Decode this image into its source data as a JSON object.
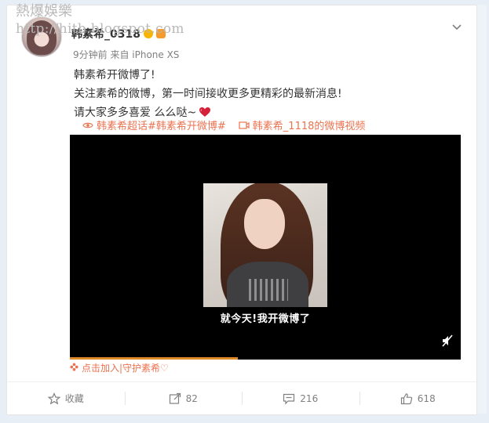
{
  "watermark": {
    "title": "熱爆娛樂",
    "url": "http://hitb.blogspot.com"
  },
  "post": {
    "username": "韩素希_0318",
    "meta": "9分钟前 来自 iPhone XS",
    "lines": [
      "韩素希开微博了!",
      "关注素希的微博，第一时间接收更多更精彩的最新消息!",
      "请大家多多喜爱 么么哒~"
    ],
    "topic_link": "韩素希超话#韩素希开微博#",
    "video_link": "韩素希_1118的微博视频",
    "video_subtitle": "就今天!我开微博了",
    "video_progress": 0.43,
    "join_text": "点击加入|守护素希♡"
  },
  "icons": {
    "more": "chevron-down-icon",
    "topic": "eye-icon",
    "video": "video-icon",
    "heart": "heart-icon",
    "mute": "mute-icon",
    "fav": "star-icon",
    "repost": "repost-icon",
    "comment": "comment-icon",
    "like": "like-icon"
  },
  "actions": {
    "favorite": "收藏",
    "repost": "82",
    "comment": "216",
    "like": "618"
  },
  "colors": {
    "accent": "#eb7350",
    "progress": "#e08a2a"
  }
}
